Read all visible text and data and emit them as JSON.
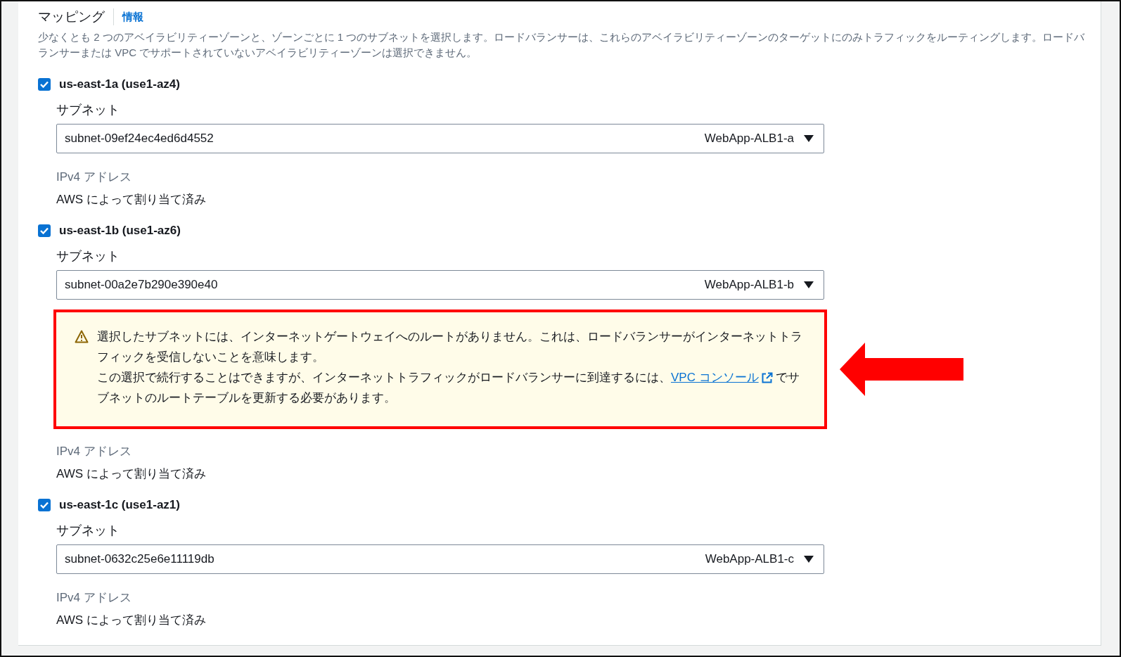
{
  "section": {
    "title": "マッピング",
    "info_link": "情報",
    "description": "少なくとも 2 つのアベイラビリティーゾーンと、ゾーンごとに 1 つのサブネットを選択します。ロードバランサーは、これらのアベイラビリティーゾーンのターゲットにのみトラフィックをルーティングします。ロードバランサーまたは VPC でサポートされていないアベイラビリティーゾーンは選択できません。"
  },
  "zones": [
    {
      "label": "us-east-1a (use1-az4)",
      "checked": true,
      "subnet_label": "サブネット",
      "subnet_value": "subnet-09ef24ec4ed6d4552",
      "subnet_name": "WebApp-ALB1-a",
      "ipv4_label": "IPv4 アドレス",
      "ipv4_value": "AWS によって割り当て済み"
    },
    {
      "label": "us-east-1b (use1-az6)",
      "checked": true,
      "subnet_label": "サブネット",
      "subnet_value": "subnet-00a2e7b290e390e40",
      "subnet_name": "WebApp-ALB1-b",
      "warning": {
        "highlighted": true,
        "line1": "選択したサブネットには、インターネットゲートウェイへのルートがありません。これは、ロードバランサーがインターネットトラフィックを受信しないことを意味します。",
        "line2_before": "この選択で続行することはできますが、インターネットトラフィックがロードバランサーに到達するには、",
        "link": "VPC コンソール",
        "line2_after": "でサブネットのルートテーブルを更新する必要があります。"
      },
      "ipv4_label": "IPv4 アドレス",
      "ipv4_value": "AWS によって割り当て済み"
    },
    {
      "label": "us-east-1c (use1-az1)",
      "checked": true,
      "subnet_label": "サブネット",
      "subnet_value": "subnet-0632c25e6e11119db",
      "subnet_name": "WebApp-ALB1-c",
      "ipv4_label": "IPv4 アドレス",
      "ipv4_value": "AWS によって割り当て済み"
    }
  ]
}
